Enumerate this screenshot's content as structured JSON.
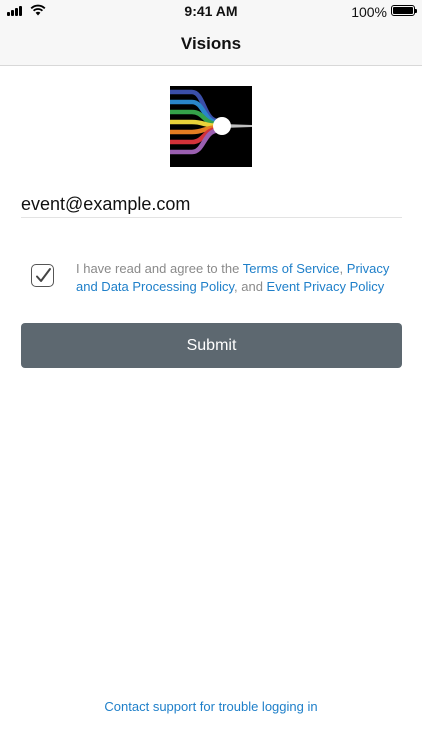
{
  "status_bar": {
    "time": "9:41 AM",
    "battery_percent": "100%",
    "battery_level": 1.0
  },
  "nav": {
    "title": "Visions"
  },
  "logo": {
    "icon": "visions-logo",
    "stripe_colors": [
      "#3b4fa8",
      "#2a86c9",
      "#35a24a",
      "#e9d23a",
      "#e57d22",
      "#d3323a",
      "#9a5fb0"
    ]
  },
  "form": {
    "email_value": "event@example.com",
    "agreement": {
      "checked": true,
      "prefix": "I have read and agree to the ",
      "terms_link": "Terms of Service",
      "sep1": ", ",
      "privacy_link": "Privacy and Data Processing Policy",
      "sep2": ", and ",
      "event_link": "Event Privacy Policy"
    },
    "submit_label": "Submit"
  },
  "footer": {
    "support_link": "Contact support for trouble logging in"
  },
  "colors": {
    "link": "#1e7fc9",
    "button_bg": "#5d6870",
    "muted_text": "#8a8a8a"
  }
}
